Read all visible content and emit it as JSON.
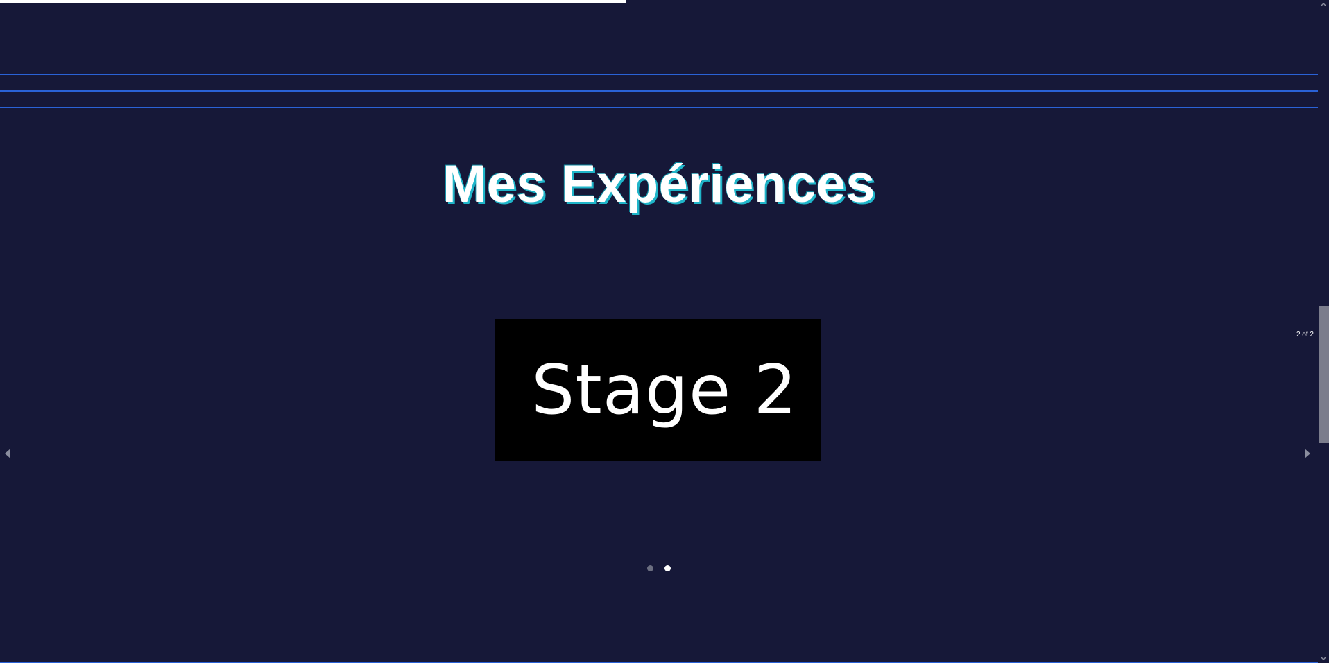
{
  "header": {
    "title": "Mes Expériences"
  },
  "slideshow": {
    "current_slide_label": "Stage 2",
    "counter_text": "2 of 2",
    "current_index": 2,
    "total_slides": 2
  },
  "progress": {
    "fraction": 0.475
  },
  "colors": {
    "background": "#161838",
    "accent_line": "#2a62d6",
    "title_shadow": "#1fb5c9",
    "card": "#000000"
  },
  "icons": {
    "prev": "triangle-left-icon",
    "next": "triangle-right-icon",
    "scroll_up": "chevron-up-icon",
    "scroll_down": "chevron-down-icon"
  }
}
